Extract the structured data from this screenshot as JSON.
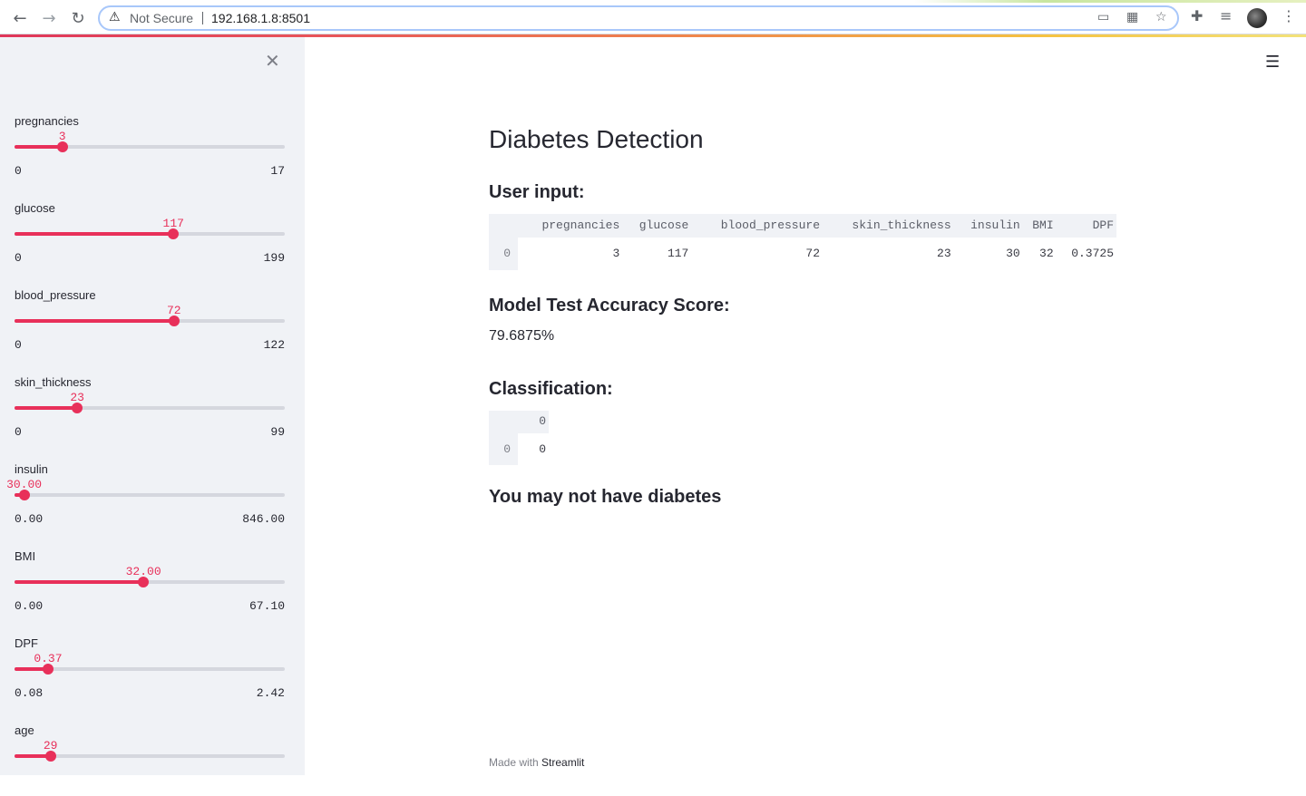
{
  "browser": {
    "security_text": "Not Secure",
    "url": "192.168.1.8:8501"
  },
  "colors": {
    "accent": "#e8305a",
    "sidebar_bg": "#f0f2f6"
  },
  "sidebar": {
    "sliders": [
      {
        "label": "pregnancies",
        "value": "3",
        "min": "0",
        "max": "17",
        "fraction": 0.1765
      },
      {
        "label": "glucose",
        "value": "117",
        "min": "0",
        "max": "199",
        "fraction": 0.588
      },
      {
        "label": "blood_pressure",
        "value": "72",
        "min": "0",
        "max": "122",
        "fraction": 0.59
      },
      {
        "label": "skin_thickness",
        "value": "23",
        "min": "0",
        "max": "99",
        "fraction": 0.232
      },
      {
        "label": "insulin",
        "value": "30.00",
        "min": "0.00",
        "max": "846.00",
        "fraction": 0.0355
      },
      {
        "label": "BMI",
        "value": "32.00",
        "min": "0.00",
        "max": "67.10",
        "fraction": 0.477
      },
      {
        "label": "DPF",
        "value": "0.37",
        "min": "0.08",
        "max": "2.42",
        "fraction": 0.124
      },
      {
        "label": "age",
        "value": "29",
        "min": "",
        "max": "",
        "fraction": 0.133
      }
    ]
  },
  "main": {
    "title": "Diabetes Detection",
    "user_input_heading": "User input:",
    "user_input_table": {
      "columns": [
        "pregnancies",
        "glucose",
        "blood_pressure",
        "skin_thickness",
        "insulin",
        "BMI",
        "DPF"
      ],
      "rows": [
        {
          "index": "0",
          "values": [
            "3",
            "117",
            "72",
            "23",
            "30",
            "32",
            "0.3725"
          ]
        }
      ]
    },
    "accuracy_heading": "Model Test Accuracy Score:",
    "accuracy_value": "79.6875%",
    "classification_heading": "Classification:",
    "classification_table": {
      "columns": [
        "0"
      ],
      "rows": [
        {
          "index": "0",
          "values": [
            "0"
          ]
        }
      ]
    },
    "result_text": "You may not have diabetes"
  },
  "footer": {
    "prefix": "Made with",
    "brand": "Streamlit"
  }
}
